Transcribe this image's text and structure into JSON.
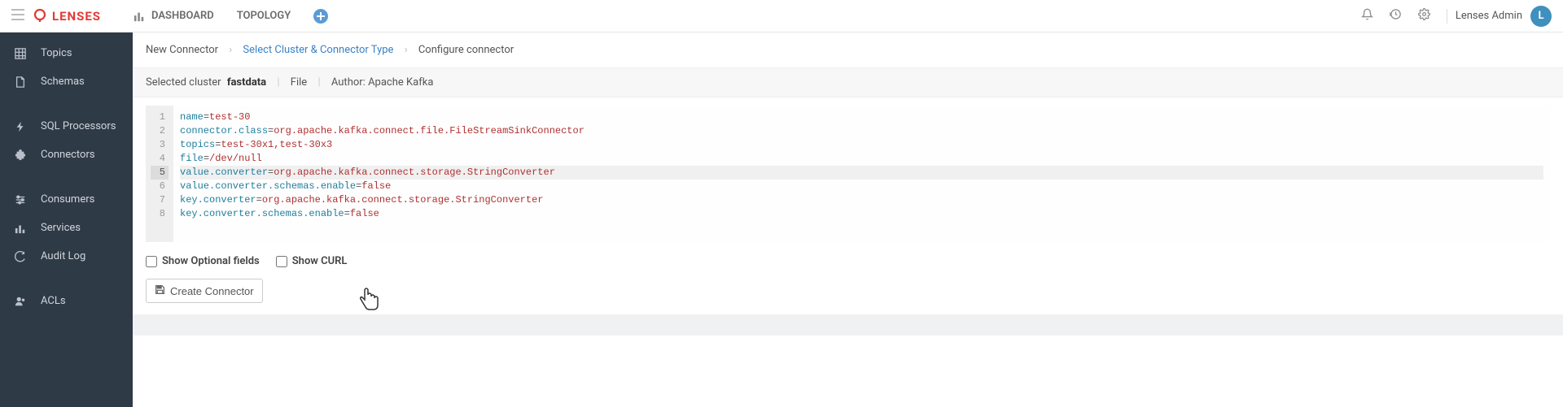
{
  "brand": {
    "name": "LENSES"
  },
  "topnav": {
    "dashboard": "DASHBOARD",
    "topology": "TOPOLOGY"
  },
  "user": {
    "name": "Lenses Admin",
    "initial": "L"
  },
  "sidebar": {
    "items": [
      {
        "label": "Topics"
      },
      {
        "label": "Schemas"
      },
      {
        "label": "SQL Processors"
      },
      {
        "label": "Connectors"
      },
      {
        "label": "Consumers"
      },
      {
        "label": "Services"
      },
      {
        "label": "Audit Log"
      },
      {
        "label": "ACLs"
      }
    ]
  },
  "breadcrumb": {
    "a": "New Connector",
    "b": "Select Cluster & Connector Type",
    "c": "Configure connector"
  },
  "meta": {
    "selected_label": "Selected cluster",
    "selected_value": "fastdata",
    "type": "File",
    "author_label": "Author:",
    "author_value": "Apache Kafka"
  },
  "editor": {
    "active_line": 5,
    "lines": [
      {
        "key": "name",
        "value": "test-30"
      },
      {
        "key": "connector.class",
        "value": "org.apache.kafka.connect.file.FileStreamSinkConnector"
      },
      {
        "key": "topics",
        "value": "test-30x1,test-30x3"
      },
      {
        "key": "file",
        "value": "/dev/null"
      },
      {
        "key": "value.converter",
        "value": "org.apache.kafka.connect.storage.StringConverter"
      },
      {
        "key": "value.converter.schemas.enable",
        "value": "false"
      },
      {
        "key": "key.converter",
        "value": "org.apache.kafka.connect.storage.StringConverter"
      },
      {
        "key": "key.converter.schemas.enable",
        "value": "false"
      }
    ]
  },
  "controls": {
    "show_optional": "Show Optional fields",
    "show_curl": "Show CURL"
  },
  "actions": {
    "create": "Create Connector"
  }
}
